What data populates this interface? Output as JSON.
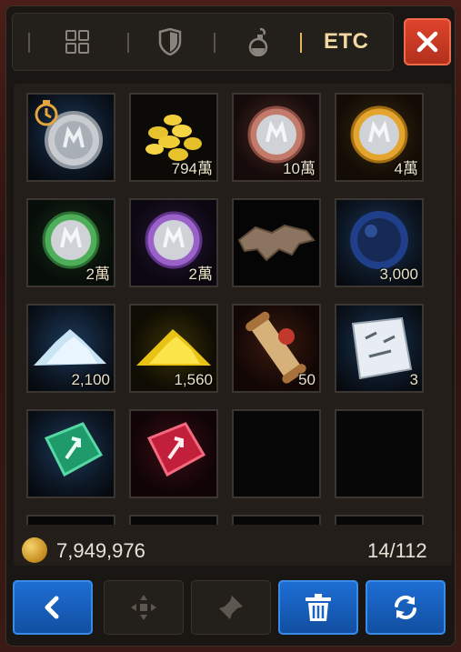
{
  "tabs": [
    {
      "name": "grid-icon"
    },
    {
      "name": "shield-icon"
    },
    {
      "name": "potion-icon"
    },
    {
      "label": "ETC",
      "active": true
    }
  ],
  "close_icon": "close-icon",
  "items": [
    {
      "name": "silver-coin-timer",
      "qty": ""
    },
    {
      "name": "gold-coins-pile",
      "qty": "794萬"
    },
    {
      "name": "bronze-medal",
      "qty": "10萬"
    },
    {
      "name": "gold-medal",
      "qty": "4萬"
    },
    {
      "name": "green-medal",
      "qty": "2萬"
    },
    {
      "name": "purple-medal",
      "qty": "2萬"
    },
    {
      "name": "leather-hide",
      "qty": ""
    },
    {
      "name": "dark-orb",
      "qty": "3,000"
    },
    {
      "name": "silver-dust",
      "qty": "2,100"
    },
    {
      "name": "gold-dust",
      "qty": "1,560"
    },
    {
      "name": "scroll",
      "qty": "50"
    },
    {
      "name": "map-paper",
      "qty": "3"
    },
    {
      "name": "green-gem",
      "qty": ""
    },
    {
      "name": "red-gem",
      "qty": ""
    },
    {
      "name": "empty",
      "qty": ""
    },
    {
      "name": "empty",
      "qty": ""
    }
  ],
  "gold": "7,949,976",
  "capacity": "14/112",
  "toolbar": [
    {
      "name": "back-button",
      "icon": "chevron-left-icon",
      "style": "blue"
    },
    {
      "name": "move-button",
      "icon": "move-icon",
      "style": "dark"
    },
    {
      "name": "pin-button",
      "icon": "pin-icon",
      "style": "dark"
    },
    {
      "name": "trash-button",
      "icon": "trash-icon",
      "style": "blue"
    },
    {
      "name": "refresh-button",
      "icon": "refresh-icon",
      "style": "blue"
    }
  ],
  "colors": {
    "accent": "#e7b55b",
    "close": "#d63a24",
    "blue": "#1a62c4"
  }
}
